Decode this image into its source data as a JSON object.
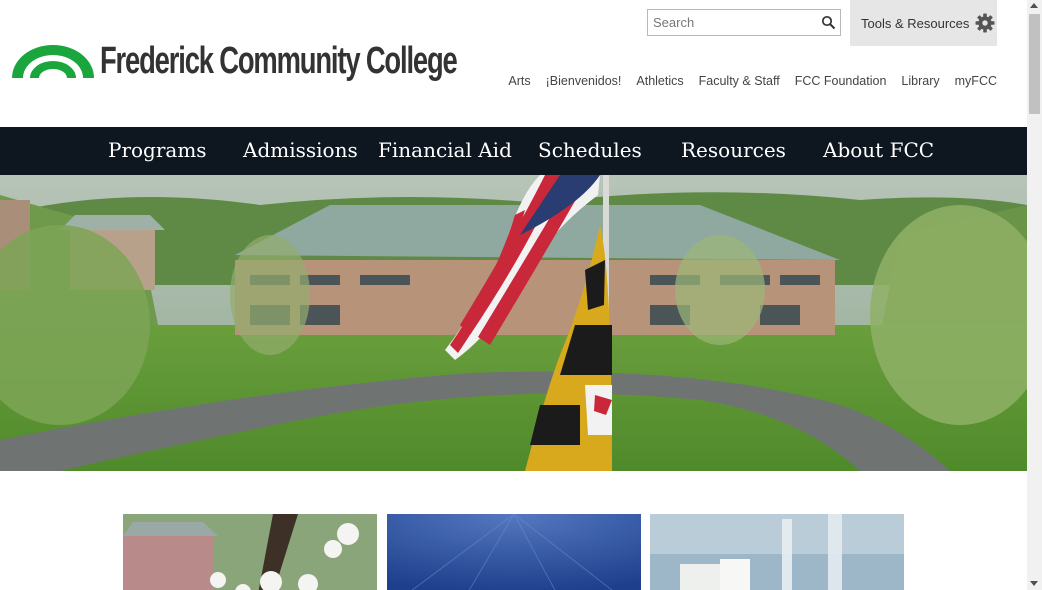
{
  "header": {
    "college_name": "Frederick Community College",
    "search": {
      "placeholder": "Search"
    },
    "tools_label": "Tools & Resources",
    "utility_links": [
      "Arts",
      "¡Bienvenidos!",
      "Athletics",
      "Faculty & Staff",
      "FCC Foundation",
      "Library",
      "myFCC"
    ]
  },
  "main_nav": [
    "Programs",
    "Admissions",
    "Financial Aid",
    "Schedules",
    "Resources",
    "About FCC"
  ],
  "colors": {
    "nav_bg": "#0e1620",
    "logo_green": "#1aa63c",
    "tools_bg": "#e6e6e6"
  },
  "icons": {
    "search": "magnifier-icon",
    "tools": "gear-icon"
  }
}
